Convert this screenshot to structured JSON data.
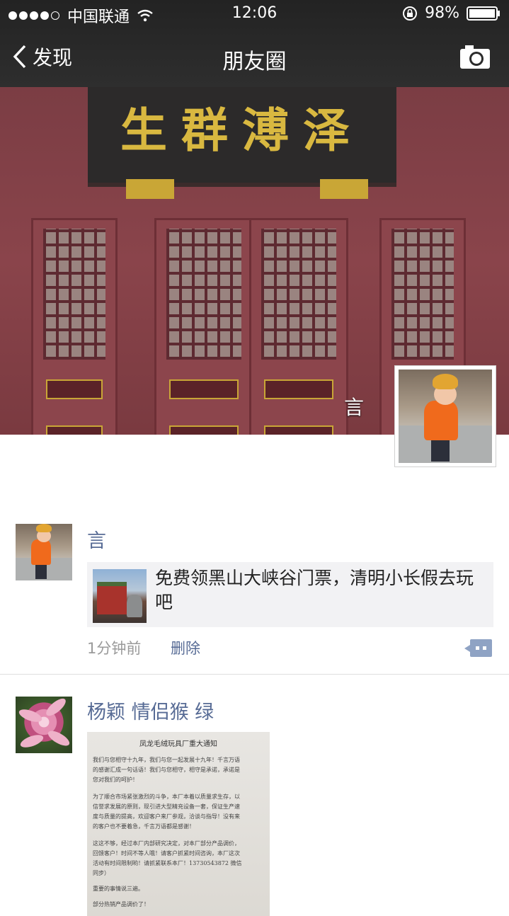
{
  "status_bar": {
    "carrier": "中国联通",
    "time": "12:06",
    "battery": "98%",
    "signal_filled": 4,
    "signal_total": 5
  },
  "nav": {
    "back_label": "发现",
    "title": "朋友圈",
    "camera_icon": "camera-icon"
  },
  "cover": {
    "plaque_text": "生群溥泽",
    "user_name": "言"
  },
  "posts": [
    {
      "author": "言",
      "link_title": "免费领黑山大峡谷门票，清明小长假去玩吧",
      "time": "1分钟前",
      "delete_label": "删除"
    },
    {
      "author": "杨颖 情侣猴 绿",
      "image_title": "凤龙毛绒玩具厂重大通知",
      "image_lines": [
        "我们与您相守十九年，我们与您一起发展十九年！千言万语",
        "的感谢汇成一句话语！我们与您相守，相守是承诺，承诺是",
        "您对我们的呵护！",
        "为了顺合市场紧张激烈的斗争，本厂本着以质量求生存，以",
        "信誉求发展的原则，现引进大型精充设备一套，保证生产速",
        "度与质量的提高，欢迎客户来厂参观，洽谈与指导！没有来",
        "的客户也不要着急，千言万语都是感谢！",
        "这这不够，经过本厂内部研究决定，对本厂部分产品调价，",
        "回馈客户！时间不等人哦！请客户抓紧时间咨询，本厂这次",
        "活动有时间限制哟！请抓紧联系本厂！13730543872 微信",
        "同步）",
        "重要的事情说三遍。",
        "部分热销产品调价了！"
      ]
    }
  ]
}
